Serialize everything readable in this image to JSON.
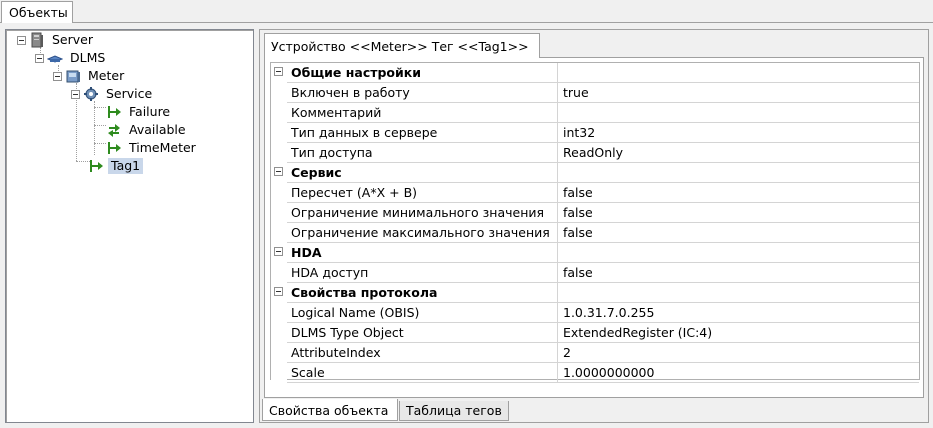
{
  "top_tab": {
    "label": "Объекты"
  },
  "tree": {
    "server": {
      "label": "Server",
      "icon": "server-icon"
    },
    "dlms": {
      "label": "DLMS",
      "icon": "protocol-icon"
    },
    "meter": {
      "label": "Meter",
      "icon": "device-icon"
    },
    "service": {
      "label": "Service",
      "icon": "gear-icon"
    },
    "failure": {
      "label": "Failure",
      "icon": "tag-arrow-icon"
    },
    "available": {
      "label": "Available",
      "icon": "tag-bidirectional-icon"
    },
    "timemeter": {
      "label": "TimeMeter",
      "icon": "tag-arrow-icon"
    },
    "tag1": {
      "label": "Tag1",
      "icon": "tag-arrow-icon",
      "selected": true
    }
  },
  "device_tab": {
    "label": "Устройство <<Meter>> Тег  <<Tag1>>"
  },
  "properties": [
    {
      "type": "category",
      "name": "Общие настройки",
      "value": ""
    },
    {
      "type": "item",
      "name": "Включен в работу",
      "value": "true"
    },
    {
      "type": "item",
      "name": "Комментарий",
      "value": ""
    },
    {
      "type": "item",
      "name": "Тип данных в сервере",
      "value": "int32"
    },
    {
      "type": "item",
      "name": "Тип доступа",
      "value": "ReadOnly"
    },
    {
      "type": "category",
      "name": "Сервис",
      "value": ""
    },
    {
      "type": "item",
      "name": "Пересчет (A*X + B)",
      "value": "false"
    },
    {
      "type": "item",
      "name": "Ограничение минимального значения",
      "value": "false"
    },
    {
      "type": "item",
      "name": "Ограничение максимального значения",
      "value": "false"
    },
    {
      "type": "category",
      "name": "HDA",
      "value": ""
    },
    {
      "type": "item",
      "name": "HDA доступ",
      "value": "false"
    },
    {
      "type": "category",
      "name": "Свойства протокола",
      "value": ""
    },
    {
      "type": "item",
      "name": "Logical Name (OBIS)",
      "value": "1.0.31.7.0.255"
    },
    {
      "type": "item",
      "name": "DLMS Type Object",
      "value": "ExtendedRegister (IC:4)"
    },
    {
      "type": "item",
      "name": "AttributeIndex",
      "value": "2"
    },
    {
      "type": "item",
      "name": "Scale",
      "value": "1.0000000000"
    }
  ],
  "bottom_tabs": [
    {
      "label": "Свойства объекта",
      "active": true
    },
    {
      "label": "Таблица тегов",
      "active": false
    }
  ],
  "colors": {
    "selection": "#c9d7ea",
    "tag_arrow": "#2e8b1e",
    "frame": "#f0f0f0"
  }
}
